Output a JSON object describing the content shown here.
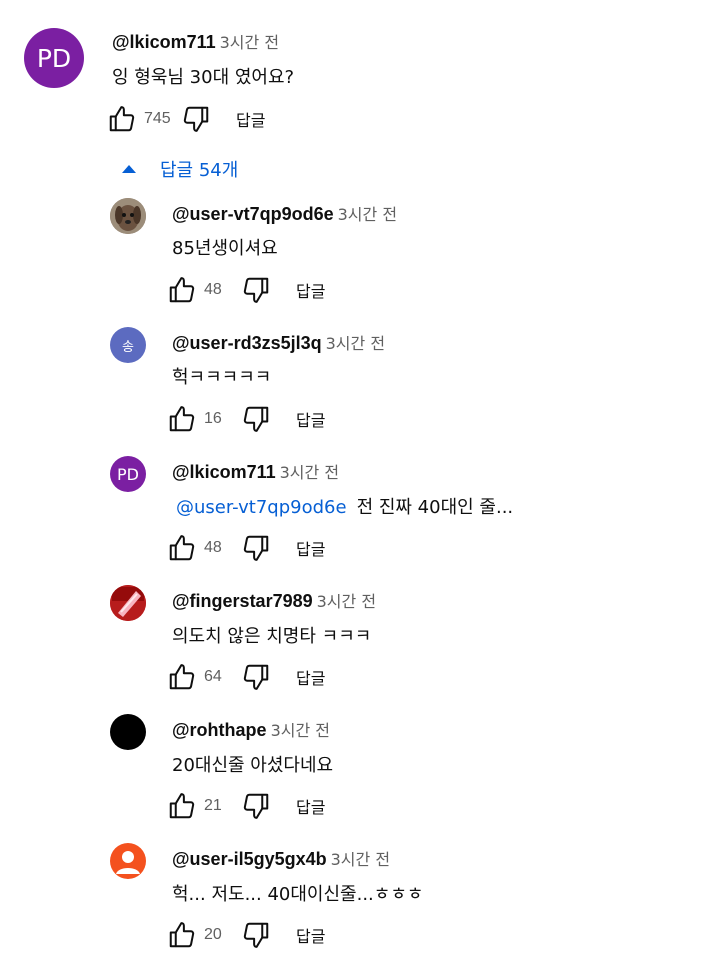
{
  "main_comment": {
    "avatar_initials": "PD",
    "author": "@lkicom711",
    "time": "3시간 전",
    "text": "잉 형욱님 30대 였어요?",
    "likes": "745",
    "reply_label": "답글"
  },
  "replies_toggle": {
    "label": "답글 54개",
    "icon": "caret-up-icon"
  },
  "replies": [
    {
      "avatar": "dog-photo",
      "author": "@user-vt7qp9od6e",
      "time": "3시간 전",
      "mention": "",
      "text": "85년생이셔요",
      "likes": "48",
      "reply_label": "답글"
    },
    {
      "avatar_initial": "송",
      "avatar_color": "#5c6bc0",
      "author": "@user-rd3zs5jl3q",
      "time": "3시간 전",
      "mention": "",
      "text": "헉ㅋㅋㅋㅋㅋ",
      "likes": "16",
      "reply_label": "답글"
    },
    {
      "avatar_initial": "PD",
      "avatar_color": "#7b1fa2",
      "author": "@lkicom711",
      "time": "3시간 전",
      "mention": "@user-vt7qp9od6e",
      "text": "전 진짜 40대인 줄...",
      "likes": "48",
      "reply_label": "답글"
    },
    {
      "avatar": "pink-object-photo",
      "author": "@fingerstar7989",
      "time": "3시간 전",
      "mention": "",
      "text": "의도치 않은 치명타 ㅋㅋㅋ",
      "likes": "64",
      "reply_label": "답글"
    },
    {
      "avatar": "black-circle",
      "author": "@rohthape",
      "time": "3시간 전",
      "mention": "",
      "text": "20대신줄 아셨다네요",
      "likes": "21",
      "reply_label": "답글"
    },
    {
      "avatar": "default-person",
      "avatar_color": "#f4511e",
      "author": "@user-il5gy5gx4b",
      "time": "3시간 전",
      "mention": "",
      "text": "헉... 저도... 40대이신줄...ㅎㅎㅎ",
      "likes": "20",
      "reply_label": "답글"
    }
  ],
  "colors": {
    "link": "#065fd4",
    "secondary_text": "#606060",
    "primary_text": "#0f0f0f"
  }
}
